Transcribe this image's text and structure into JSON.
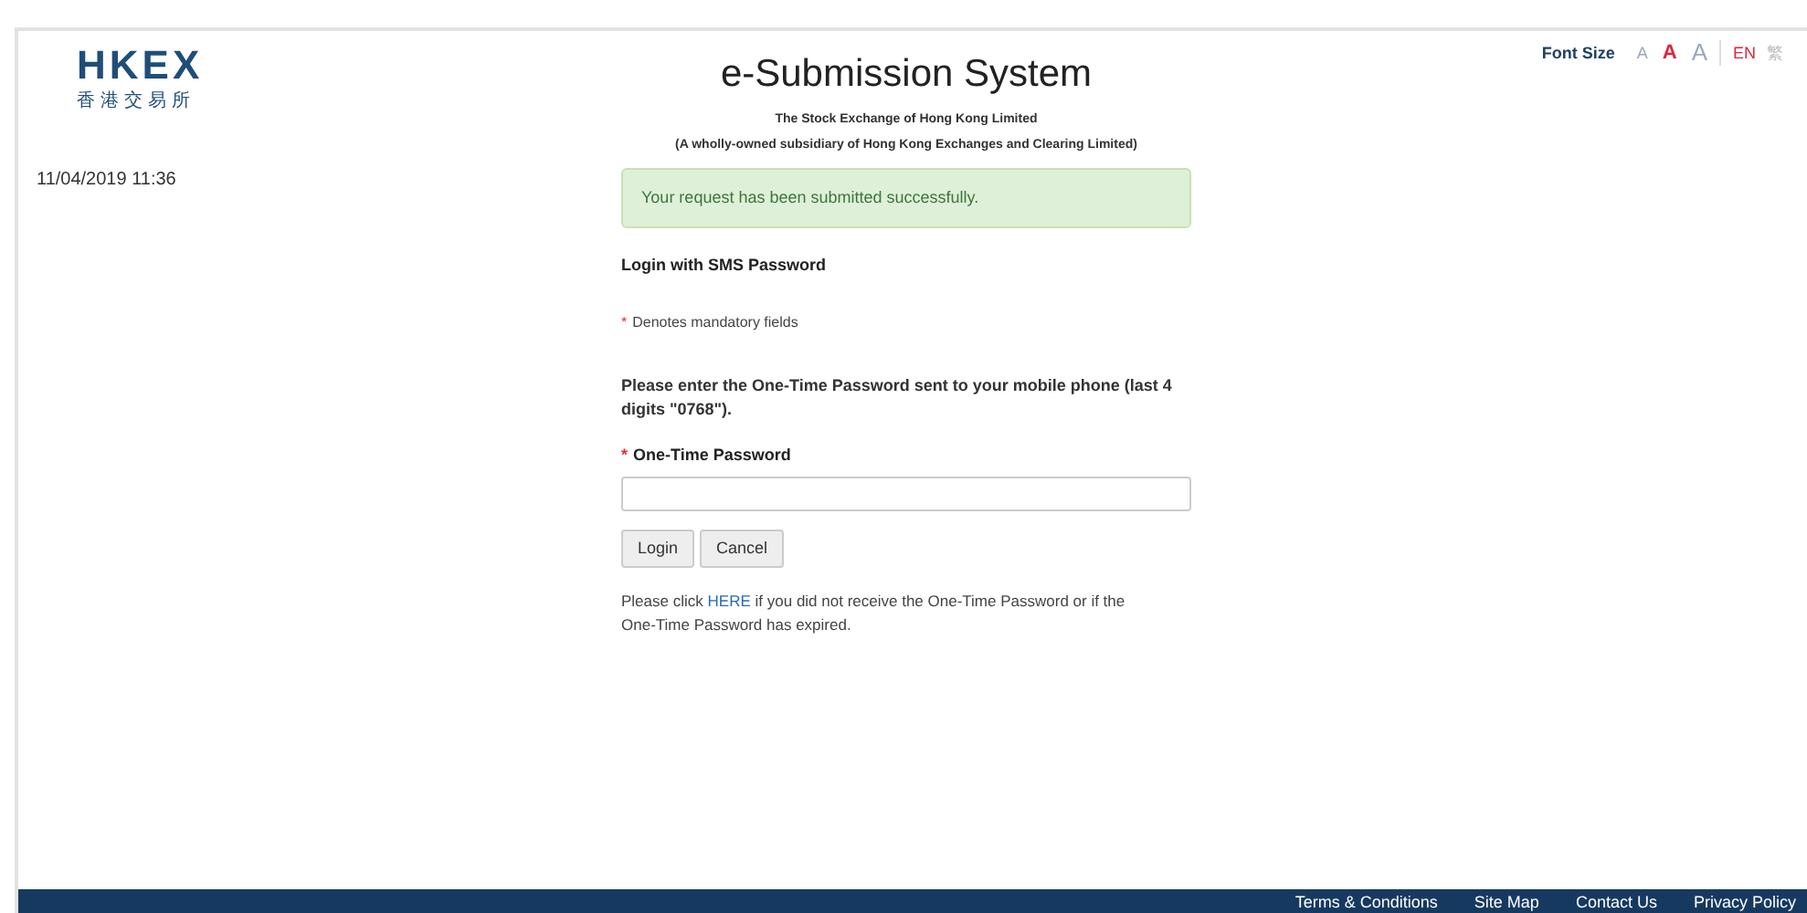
{
  "logo": {
    "wordmark": "HKEX",
    "chinese": "香港交易所"
  },
  "datetime": "11/04/2019 11:36",
  "font_size": {
    "label": "Font Size",
    "options": [
      {
        "label": "A",
        "kind": "small",
        "selected": false
      },
      {
        "label": "A",
        "kind": "medium",
        "selected": true
      },
      {
        "label": "A",
        "kind": "large",
        "selected": false
      }
    ]
  },
  "languages": [
    {
      "label": "EN",
      "selected": true
    },
    {
      "label": "繁",
      "selected": false
    }
  ],
  "header": {
    "title": "e-Submission System",
    "subtitle": "The Stock Exchange of Hong Kong Limited",
    "note": "(A wholly-owned subsidiary of Hong Kong Exchanges and Clearing Limited)"
  },
  "alert": "Your request has been submitted successfully.",
  "form": {
    "heading": "Login with SMS Password",
    "mandatory_mark": "*",
    "mandatory_note": "Denotes mandatory fields",
    "instruction": "Please enter the One-Time Password sent to your mobile phone (last 4 digits \"0768\").",
    "field_label": "One-Time Password",
    "buttons": [
      "Login",
      "Cancel"
    ],
    "help_before": "Please click",
    "help_link": "HERE",
    "help_after": "if you did not receive the One-Time Password or if the One-Time Password has expired."
  },
  "footer_links": [
    "Terms & Conditions",
    "Site Map",
    "Contact Us",
    "Privacy Policy"
  ]
}
